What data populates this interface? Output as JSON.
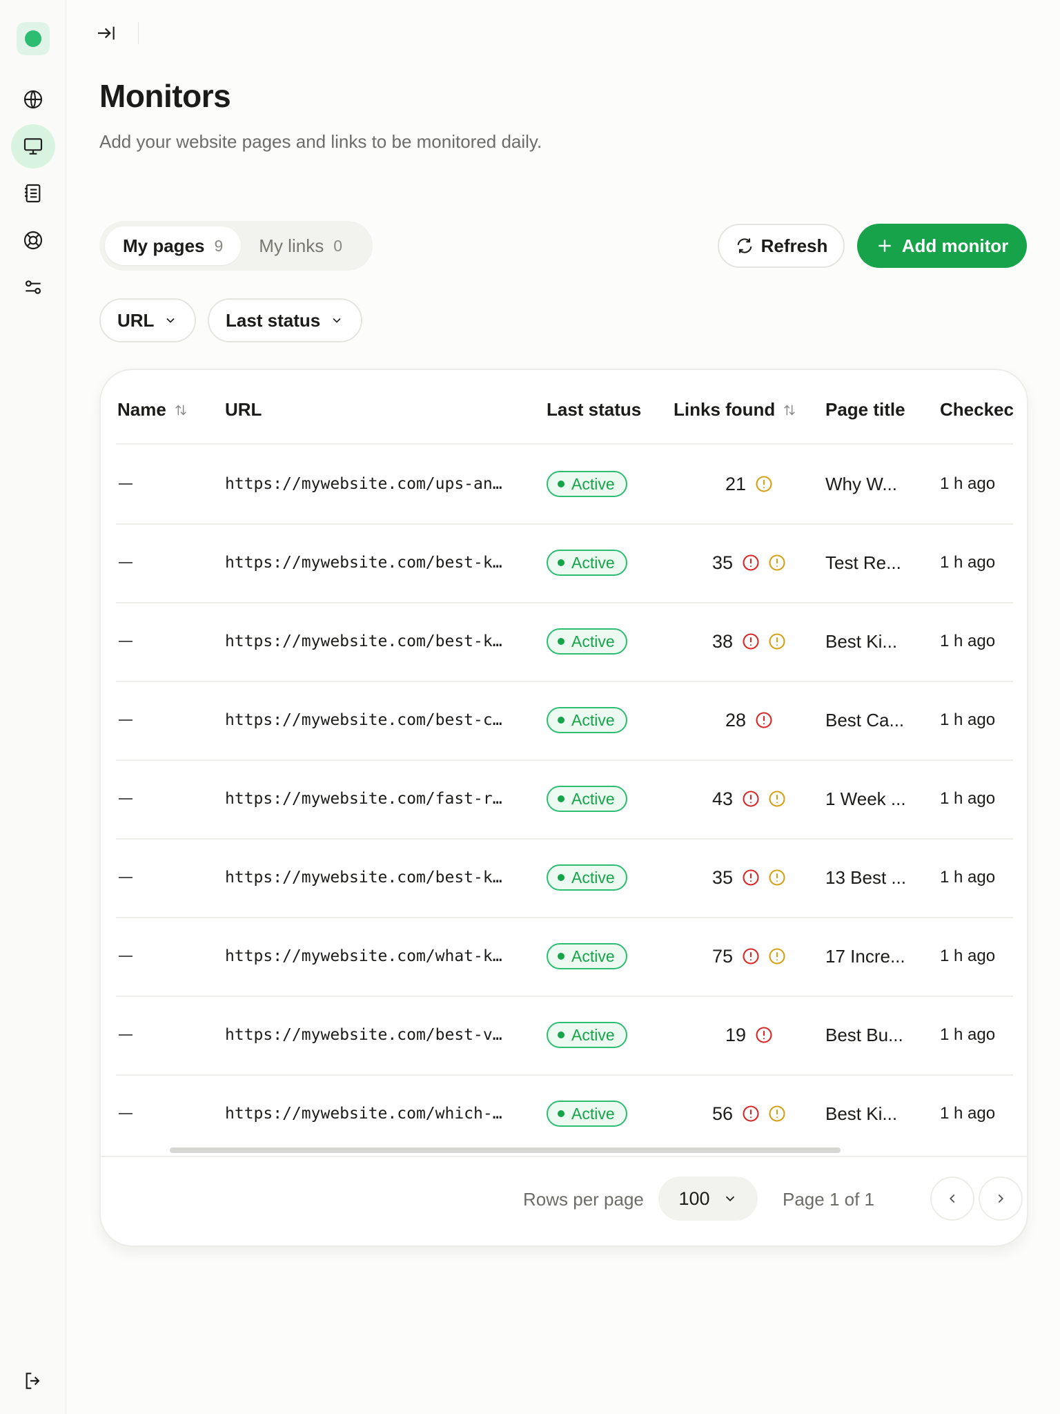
{
  "sidebar": {
    "nav": [
      {
        "name": "globe-icon"
      },
      {
        "name": "monitor-icon",
        "active": true
      },
      {
        "name": "document-list-icon"
      },
      {
        "name": "lifebuoy-icon"
      },
      {
        "name": "sliders-icon"
      }
    ],
    "bottom": {
      "name": "logout-icon"
    }
  },
  "header": {
    "title": "Monitors",
    "subtitle": "Add your website pages and links to be monitored daily."
  },
  "tabs": [
    {
      "label": "My pages",
      "count": "9",
      "active": true
    },
    {
      "label": "My links",
      "count": "0",
      "active": false
    }
  ],
  "actions": {
    "refresh_label": "Refresh",
    "add_label": "Add monitor"
  },
  "filters": [
    {
      "label": "URL"
    },
    {
      "label": "Last status"
    }
  ],
  "table": {
    "columns": {
      "name": "Name",
      "url": "URL",
      "status": "Last status",
      "links": "Links found",
      "title": "Page title",
      "checked": "Checkec"
    },
    "rows": [
      {
        "url": "https://mywebsite.com/ups-an…",
        "status": "Active",
        "links": "21",
        "warn_red": false,
        "warn_amber": true,
        "title": "Why W...",
        "checked": "1 h ago"
      },
      {
        "url": "https://mywebsite.com/best-k…",
        "status": "Active",
        "links": "35",
        "warn_red": true,
        "warn_amber": true,
        "title": "Test Re...",
        "checked": "1 h ago"
      },
      {
        "url": "https://mywebsite.com/best-k…",
        "status": "Active",
        "links": "38",
        "warn_red": true,
        "warn_amber": true,
        "title": "Best Ki...",
        "checked": "1 h ago"
      },
      {
        "url": "https://mywebsite.com/best-c…",
        "status": "Active",
        "links": "28",
        "warn_red": true,
        "warn_amber": false,
        "title": "Best Ca...",
        "checked": "1 h ago"
      },
      {
        "url": "https://mywebsite.com/fast-r…",
        "status": "Active",
        "links": "43",
        "warn_red": true,
        "warn_amber": true,
        "title": "1 Week ...",
        "checked": "1 h ago"
      },
      {
        "url": "https://mywebsite.com/best-k…",
        "status": "Active",
        "links": "35",
        "warn_red": true,
        "warn_amber": true,
        "title": "13 Best ...",
        "checked": "1 h ago"
      },
      {
        "url": "https://mywebsite.com/what-k…",
        "status": "Active",
        "links": "75",
        "warn_red": true,
        "warn_amber": true,
        "title": "17 Incre...",
        "checked": "1 h ago"
      },
      {
        "url": "https://mywebsite.com/best-v…",
        "status": "Active",
        "links": "19",
        "warn_red": true,
        "warn_amber": false,
        "title": "Best Bu...",
        "checked": "1 h ago"
      },
      {
        "url": "https://mywebsite.com/which-…",
        "status": "Active",
        "links": "56",
        "warn_red": true,
        "warn_amber": true,
        "title": "Best Ki...",
        "checked": "1 h ago"
      }
    ]
  },
  "pagination": {
    "rows_per_page_label": "Rows per page",
    "rows_per_page": "100",
    "page_label": "Page 1 of 1"
  },
  "colors": {
    "accent": "#16a34a",
    "active_nav": "#d8f3df",
    "warn_red": "#dc2626",
    "warn_amber": "#d4a017"
  }
}
